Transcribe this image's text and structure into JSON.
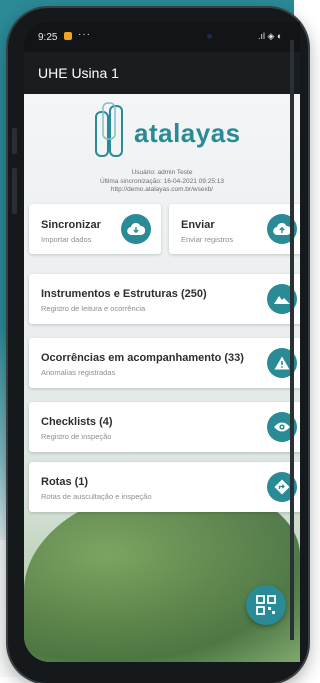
{
  "statusbar": {
    "time": "9:25",
    "dots": "···",
    "icons": ".ıl ◈ ◐"
  },
  "appbar": {
    "title": "UHE Usina 1"
  },
  "brand": {
    "logo_text": "atalayas",
    "color": "#2a8a96"
  },
  "info": {
    "user": "Usuário: admin Teste",
    "sync": "Última sincronização: 16-04-2021 09:25:13",
    "url": "http://demo.atalayas.com.br/wsexb/"
  },
  "cards": {
    "sincronizar": {
      "title": "Sincronizar",
      "subtitle": "Importar dados",
      "icon": "cloud-download-icon"
    },
    "enviar": {
      "title": "Enviar",
      "subtitle": "Enviar registros",
      "icon": "cloud-upload-icon"
    },
    "instrumentos": {
      "title": "Instrumentos e Estruturas (250)",
      "subtitle": "Registro de leitura e ocorrência",
      "icon": "landscape-icon"
    },
    "ocorrencias": {
      "title": "Ocorrências em acompanhamento (33)",
      "subtitle": "Anomalias registradas",
      "icon": "warning-icon"
    },
    "checklists": {
      "title": "Checklists (4)",
      "subtitle": "Registro de inspeção",
      "icon": "eye-icon"
    },
    "rotas": {
      "title": "Rotas (1)",
      "subtitle": "Rotas de auscultação e inspeção",
      "icon": "directions-icon"
    }
  },
  "fab": {
    "icon": "qr-code-icon"
  }
}
